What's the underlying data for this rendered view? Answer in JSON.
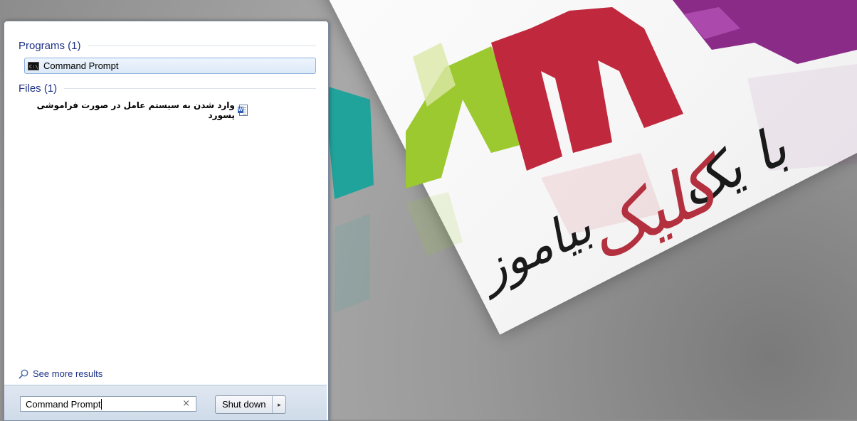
{
  "start_menu": {
    "programs_header": "Programs (1)",
    "files_header": "Files (1)",
    "program_results": [
      {
        "label": "Command Prompt",
        "icon": "cmd-icon"
      }
    ],
    "file_results": [
      {
        "label": "وارد شدن به سیستم عامل در صورت فراموشی پسورد",
        "icon": "word-doc-icon"
      }
    ],
    "see_more_label": "See more results",
    "search": {
      "value": "Command Prompt",
      "clear_icon": "×"
    },
    "shutdown_label": "Shut down",
    "shutdown_arrow": "▸"
  },
  "wallpaper": {
    "brand_letters": "RAMS",
    "calligraphy": [
      "با یک",
      "کلیک",
      "بیاموز"
    ],
    "colors": {
      "teal": "#1fa39a",
      "green": "#9bc92f",
      "red": "#c0283d",
      "purple": "#8a2b88"
    }
  }
}
